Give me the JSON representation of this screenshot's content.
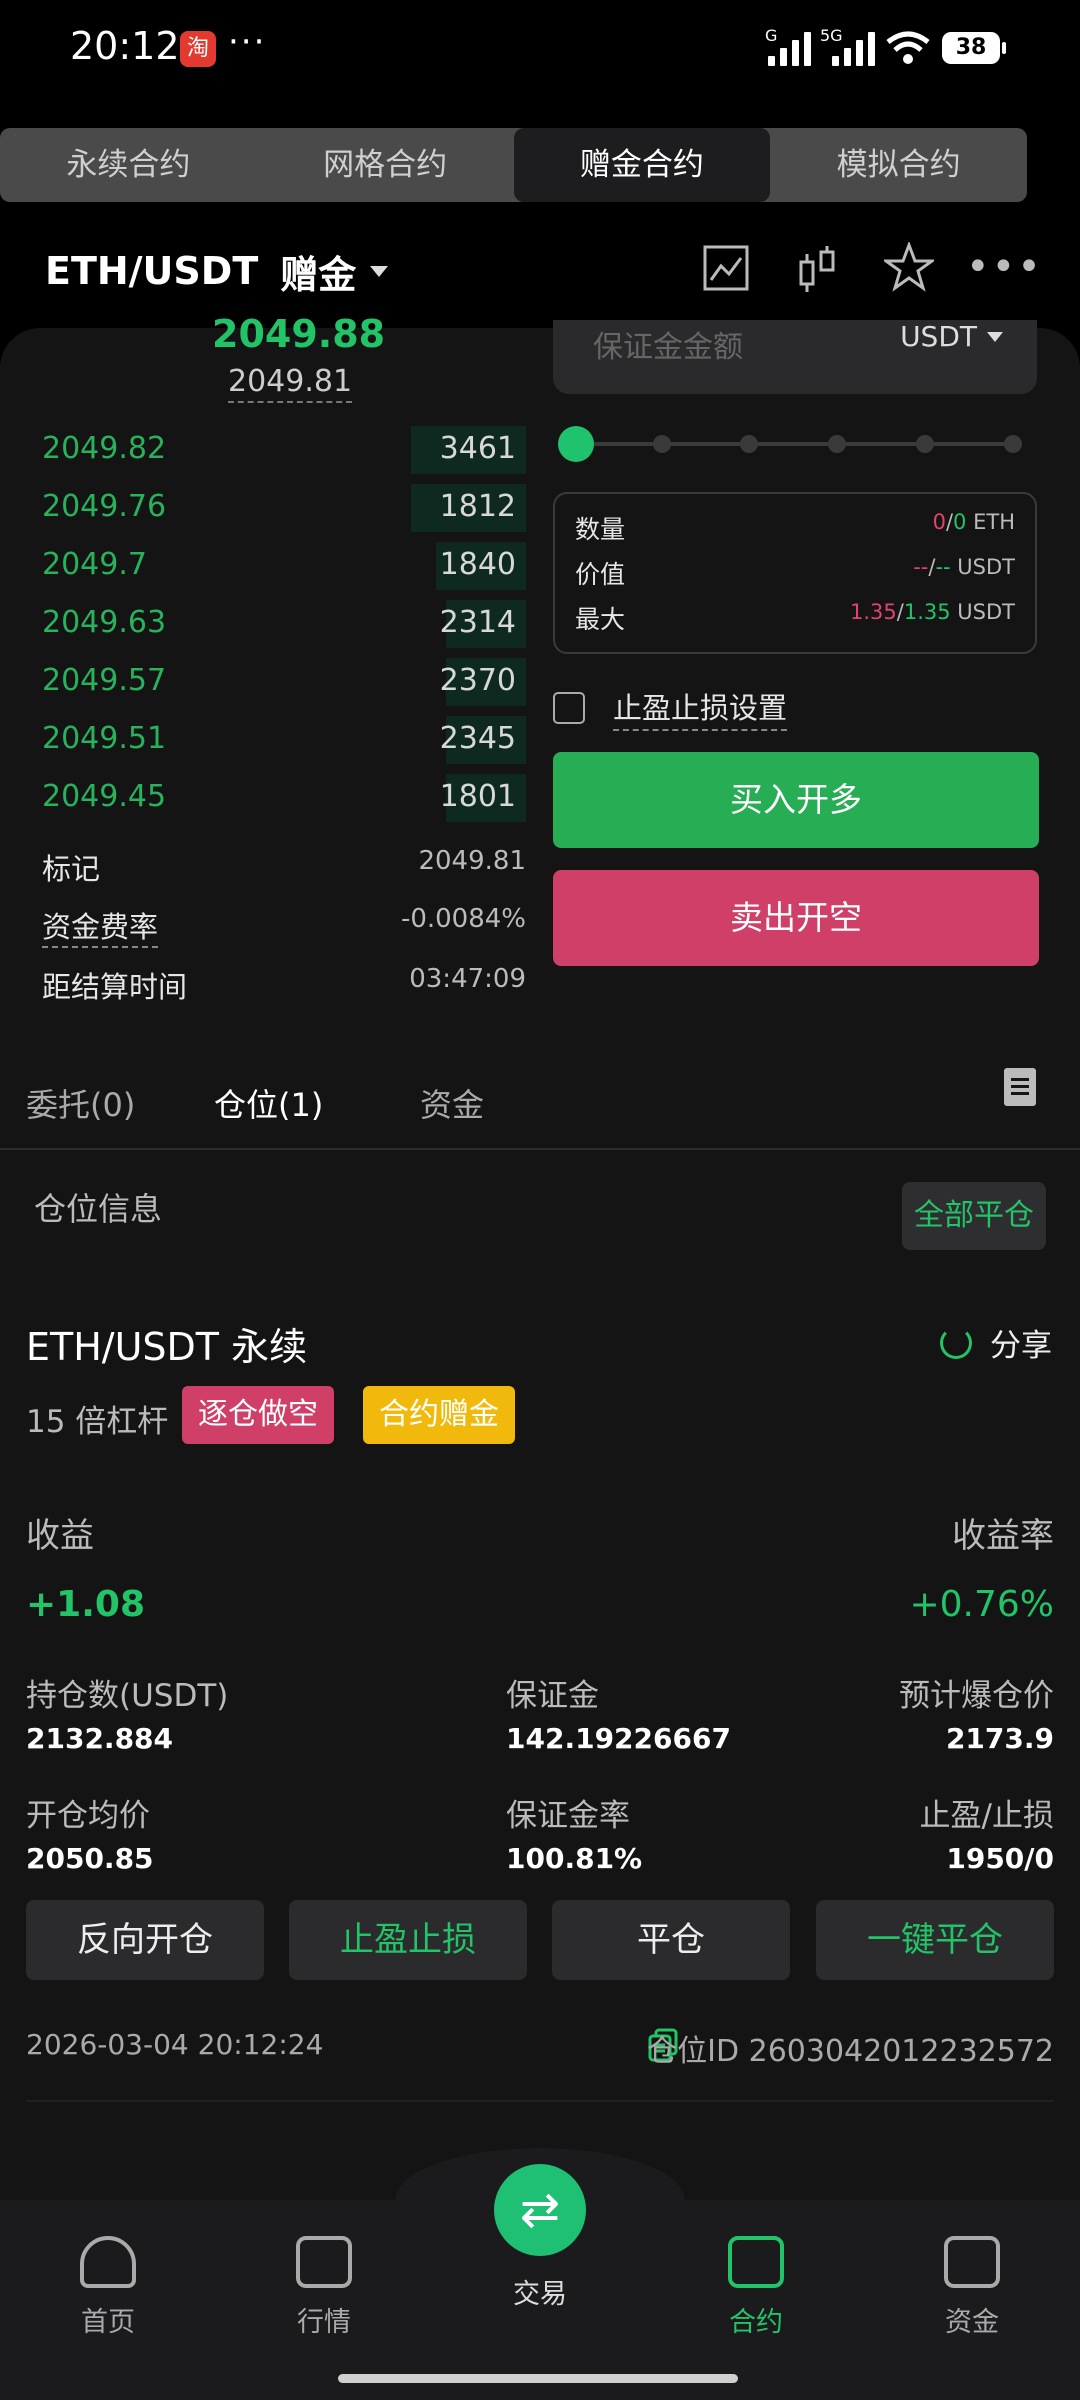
{
  "status": {
    "time": "20:12",
    "app_badge": "淘",
    "more": "···",
    "net1": "G",
    "net2": "5G",
    "battery": "38"
  },
  "contract_tabs": [
    "永续合约",
    "网格合约",
    "赠金合约",
    "模拟合约"
  ],
  "header": {
    "pair": "ETH/USDT",
    "pair_type": "赠金"
  },
  "orderbook": {
    "last_price": "2049.88",
    "mark_price": "2049.81",
    "bids": [
      {
        "price": "2049.82",
        "qty": "3461"
      },
      {
        "price": "2049.76",
        "qty": "1812"
      },
      {
        "price": "2049.7",
        "qty": "1840"
      },
      {
        "price": "2049.63",
        "qty": "2314"
      },
      {
        "price": "2049.57",
        "qty": "2370"
      },
      {
        "price": "2049.51",
        "qty": "2345"
      },
      {
        "price": "2049.45",
        "qty": "1801"
      }
    ],
    "mark_label": "标记",
    "mark_value": "2049.81",
    "funding_label": "资金费率",
    "funding_value": "-0.0084%",
    "settle_label": "距结算时间",
    "settle_value": "03:47:09"
  },
  "form": {
    "margin_placeholder": "保证金金额",
    "margin_currency": "USDT",
    "qty_label": "数量",
    "qty_a": "0",
    "qty_b": "0",
    "qty_unit": "ETH",
    "value_label": "价值",
    "value_a": "--",
    "value_b": "--",
    "value_unit": "USDT",
    "max_label": "最大",
    "max_a": "1.35",
    "max_b": "1.35",
    "max_unit": "USDT",
    "sep": "/",
    "tpsl_label": "止盈止损设置",
    "buy_label": "买入开多",
    "sell_label": "卖出开空"
  },
  "lower_tabs": {
    "orders": "委托(0)",
    "positions": "仓位(1)",
    "funds": "资金"
  },
  "positions": {
    "section_title": "仓位信息",
    "close_all": "全部平仓",
    "symbol": "ETH/USDT 永续",
    "share": "分享",
    "leverage": "15 倍杠杆",
    "tag_short": "逐仓做空",
    "tag_bonus": "合约赠金",
    "pnl_label": "收益",
    "pnl_value": "+1.08",
    "roe_label": "收益率",
    "roe_value": "+0.76%",
    "size_label": "持仓数(USDT)",
    "size_value": "2132.884",
    "margin_label": "保证金",
    "margin_value": "142.19226667",
    "liq_label": "预计爆仓价",
    "liq_value": "2173.9",
    "entry_label": "开仓均价",
    "entry_value": "2050.85",
    "mratio_label": "保证金率",
    "mratio_value": "100.81%",
    "tpsl_label": "止盈/止损",
    "tpsl_value": "1950/0",
    "actions": [
      "反向开仓",
      "止盈止损",
      "平仓",
      "一键平仓"
    ],
    "timestamp": "2026-03-04 20:12:24",
    "position_id": "仓位ID 2603042012232572"
  },
  "nav": {
    "home": "首页",
    "market": "行情",
    "trade": "交易",
    "contract": "合约",
    "assets": "资金"
  },
  "colors": {
    "green": "#23c368",
    "red": "#cf3f68",
    "yellow": "#f0b90b",
    "bg": "#141414"
  }
}
